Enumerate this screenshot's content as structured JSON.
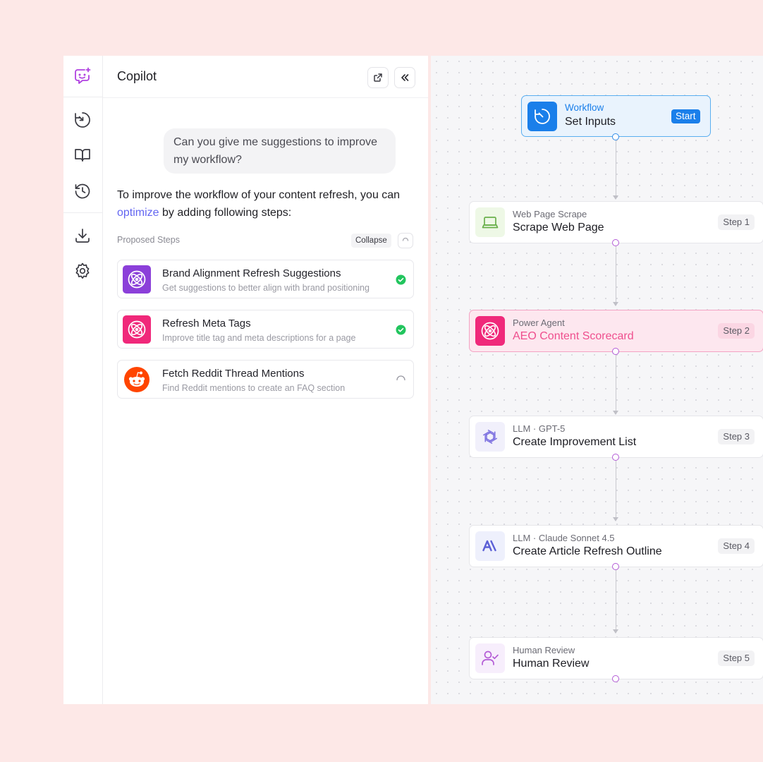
{
  "colors": {
    "page_bg": "#fde8e7",
    "accent_link": "#6366f1",
    "brand_purple": "#8b3fd9",
    "brand_pink": "#f0287a",
    "reddit_orange": "#ff4500",
    "workflow_blue": "#1a7fea",
    "highlight_pink": "#ef4f8e",
    "success_green": "#22c55e"
  },
  "rail": {
    "icons": [
      "copilot-icon",
      "clock-arrow-icon",
      "book-icon",
      "history-icon",
      "download-icon",
      "gear-icon"
    ]
  },
  "copilot": {
    "title": "Copilot",
    "user_message": "Can you give me suggestions to improve my workflow?",
    "answer": {
      "before": "To improve the workflow of your content refresh, you can ",
      "highlight": "optimize",
      "after": " by adding following steps:"
    },
    "proposed_label": "Proposed Steps",
    "collapse_label": "Collapse",
    "steps": [
      {
        "title": "Brand Alignment Refresh Suggestions",
        "subtitle": "Get suggestions to better align with brand positioning",
        "status": "done",
        "icon": "atom-icon"
      },
      {
        "title": "Refresh Meta Tags",
        "subtitle": "Improve title tag and meta descriptions for a page",
        "status": "done",
        "icon": "atom-icon"
      },
      {
        "title": "Fetch Reddit Thread Mentions",
        "subtitle": "Find Reddit mentions to create an FAQ section",
        "status": "loading",
        "icon": "reddit-icon"
      }
    ]
  },
  "workflow": {
    "start": {
      "subtitle": "Workflow",
      "title": "Set Inputs",
      "badge": "Start"
    },
    "nodes": [
      {
        "subtitle": "Web Page Scrape",
        "title": "Scrape Web Page",
        "step": "Step 1"
      },
      {
        "subtitle": "Power Agent",
        "title": "AEO Content Scorecard",
        "step": "Step 2"
      },
      {
        "subtitle": "LLM · GPT-5",
        "title": "Create Improvement List",
        "step": "Step 3"
      },
      {
        "subtitle": "LLM · Claude Sonnet 4.5",
        "title": "Create Article Refresh Outline",
        "step": "Step 4"
      },
      {
        "subtitle": "Human Review",
        "title": "Human Review",
        "step": "Step 5"
      }
    ]
  }
}
